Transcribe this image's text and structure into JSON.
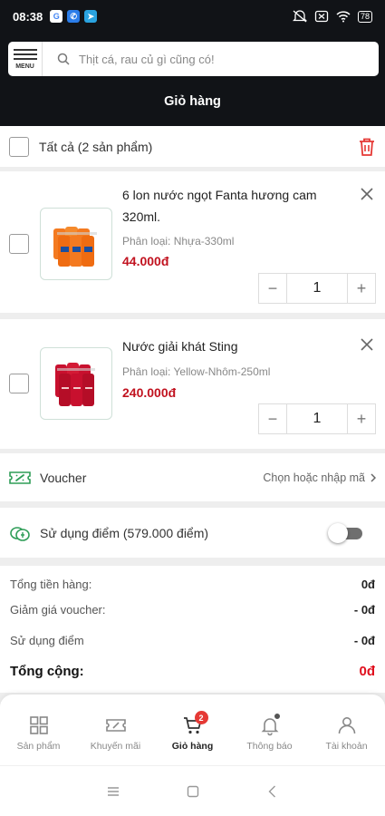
{
  "status_bar": {
    "time": "08:38",
    "battery": "78"
  },
  "header": {
    "menu_label": "MENU",
    "search_placeholder": "Thịt cá, rau củ gì cũng có!",
    "title": "Giỏ hàng"
  },
  "cart": {
    "select_all_label": "Tất cả (2 sản phẩm)",
    "items": [
      {
        "name": "6 lon nước ngọt Fanta hương cam 320ml.",
        "variant": "Phân loại: Nhựa-330ml",
        "price": "44.000đ",
        "quantity": "1"
      },
      {
        "name": "Nước giải khát Sting",
        "variant": "Phân loại: Yellow-Nhôm-250ml",
        "price": "240.000đ",
        "quantity": "1"
      }
    ]
  },
  "voucher": {
    "label": "Voucher",
    "hint": "Chọn hoặc nhập mã"
  },
  "points": {
    "label": "Sử dụng điểm (579.000 điểm)",
    "enabled": false
  },
  "summary": {
    "subtotal_label": "Tổng tiền hàng:",
    "subtotal_value": "0đ",
    "voucher_label": "Giảm giá voucher:",
    "voucher_value": "- 0đ",
    "points_label": "Sử dụng điểm",
    "points_value": "- 0đ",
    "total_label": "Tổng cộng:",
    "total_value": "0đ"
  },
  "tabs": [
    {
      "label": "Sản phẩm",
      "icon": "grid-icon"
    },
    {
      "label": "Khuyến mãi",
      "icon": "ticket-icon"
    },
    {
      "label": "Giỏ hàng",
      "icon": "cart-icon",
      "badge": "2",
      "active": true
    },
    {
      "label": "Thông báo",
      "icon": "bell-icon"
    },
    {
      "label": "Tài khoản",
      "icon": "user-icon"
    }
  ],
  "colors": {
    "header_bg": "#111317",
    "price": "#c1121f",
    "total": "#e0101e",
    "badge": "#e53935",
    "brand_green": "#2e9d57"
  }
}
